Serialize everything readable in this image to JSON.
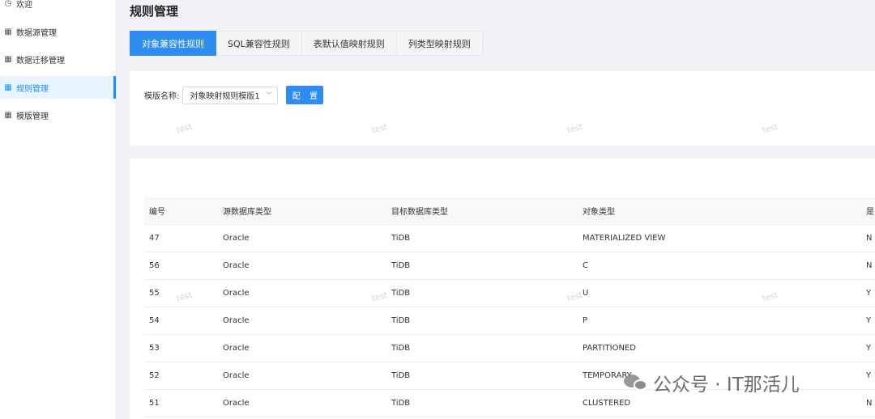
{
  "sidebar": {
    "items": [
      {
        "label": "欢迎",
        "icon": "clock-icon",
        "active": false
      },
      {
        "label": "数据源管理",
        "icon": "grid-icon",
        "active": false
      },
      {
        "label": "数据迁移管理",
        "icon": "grid-icon",
        "active": false
      },
      {
        "label": "规则管理",
        "icon": "grid-icon",
        "active": true
      },
      {
        "label": "模版管理",
        "icon": "grid-icon",
        "active": false
      }
    ]
  },
  "page": {
    "title": "规则管理"
  },
  "tabs": [
    {
      "label": "对象兼容性规则",
      "active": true
    },
    {
      "label": "SQL兼容性规则",
      "active": false
    },
    {
      "label": "表默认值映射规则",
      "active": false
    },
    {
      "label": "列类型映射规则",
      "active": false
    }
  ],
  "filter": {
    "label": "模版名称:",
    "select_value": "对象映射规则模版1",
    "config_button": "配 置"
  },
  "table": {
    "headers": [
      "编号",
      "源数据库类型",
      "目标数据库类型",
      "对象类型",
      "是"
    ],
    "rows": [
      [
        "47",
        "Oracle",
        "TiDB",
        "MATERIALIZED VIEW",
        "N"
      ],
      [
        "56",
        "Oracle",
        "TiDB",
        "C",
        "N"
      ],
      [
        "55",
        "Oracle",
        "TiDB",
        "U",
        "Y"
      ],
      [
        "54",
        "Oracle",
        "TiDB",
        "P",
        "Y"
      ],
      [
        "53",
        "Oracle",
        "TiDB",
        "PARTITIONED",
        "Y"
      ],
      [
        "52",
        "Oracle",
        "TiDB",
        "TEMPORARY",
        "Y"
      ],
      [
        "51",
        "Oracle",
        "TiDB",
        "CLUSTERED",
        "N"
      ]
    ]
  },
  "watermark": {
    "text": "test"
  },
  "brand": {
    "text": "公众号 · IT那活儿"
  },
  "colors": {
    "accent": "#2d8cf0",
    "sidebar_active_bg": "#e8f4ff",
    "background": "#f0f2f5"
  }
}
